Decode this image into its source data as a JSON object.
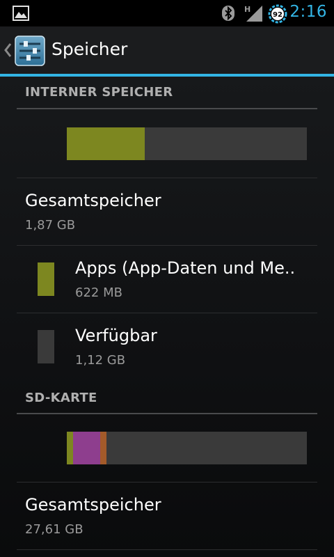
{
  "status_bar": {
    "time": "2:16",
    "battery_level": "92",
    "signal_type": "H",
    "icons": [
      "gallery-icon",
      "bluetooth-icon",
      "signal-icon",
      "battery-icon"
    ]
  },
  "action_bar": {
    "title": "Speicher",
    "icon": "settings-sliders-icon",
    "back_icon": "chevron-left-icon"
  },
  "internal": {
    "header": "INTERNER SPEICHER",
    "bar": {
      "used_fraction": 0.325,
      "used_color": "#7d8720",
      "free_color": "#3a3a3a"
    },
    "total": {
      "title": "Gesamtspeicher",
      "value": "1,87 GB"
    },
    "items": [
      {
        "title": "Apps (App-Daten und Me..",
        "value": "622 MB",
        "color": "#7d8720"
      },
      {
        "title": "Verfügbar",
        "value": "1,12 GB",
        "color": "#3a3a3a"
      }
    ]
  },
  "sd": {
    "header": "SD-KARTE",
    "bar": {
      "segments": [
        {
          "fraction": 0.025,
          "color": "#7d8720"
        },
        {
          "fraction": 0.115,
          "color": "#8e3e8e"
        },
        {
          "fraction": 0.025,
          "color": "#a35a2a"
        }
      ],
      "free_color": "#3a3a3a"
    },
    "total": {
      "title": "Gesamtspeicher",
      "value": "27,61 GB"
    }
  },
  "colors": {
    "accent": "#33b5e5"
  }
}
